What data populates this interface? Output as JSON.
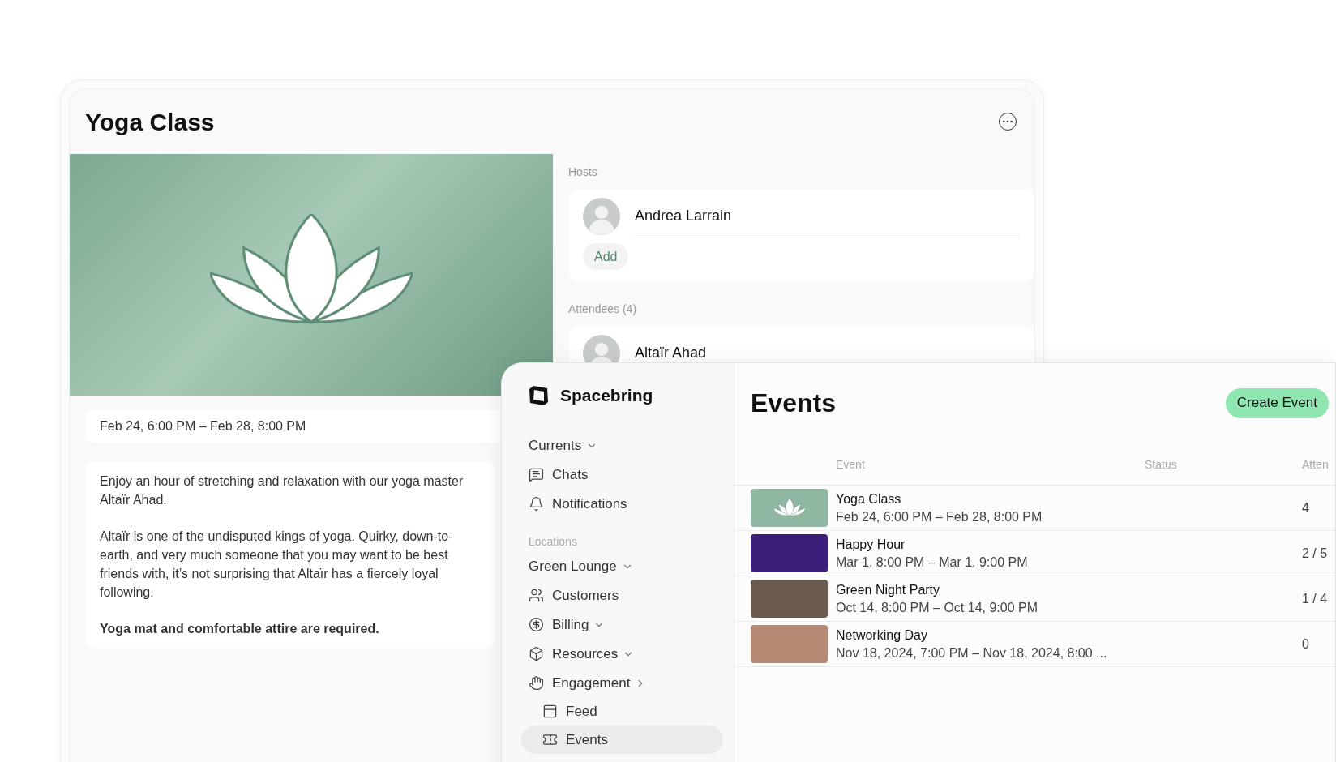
{
  "event_window": {
    "title": "Yoga Class",
    "date": "Feb 24, 6:00 PM – Feb 28, 8:00 PM",
    "description": [
      {
        "text": "Enjoy an hour of stretching and relaxation with our yoga master Altaïr Ahad.",
        "bold": false
      },
      {
        "text": "Altaïr is one of the undisputed kings of yoga. Quirky, down-to-earth, and very much someone that you may want to be best friends with, it’s not surprising that Altaïr has a fiercely loyal following.",
        "bold": false
      },
      {
        "text": "Yoga mat and comfortable attire are required.",
        "bold": true
      }
    ],
    "hosts": {
      "label": "Hosts",
      "people": [
        "Andrea Larrain"
      ],
      "add_button": "Add"
    },
    "attendees": {
      "label": "Attendees (4)",
      "people": [
        "Altaïr Ahad"
      ]
    }
  },
  "app_window": {
    "sidebar": {
      "logo": "Spacebring",
      "items": [
        {
          "kind": "group",
          "label": "Currents",
          "expanded": true
        },
        {
          "kind": "link",
          "label": "Chats",
          "selected": false
        },
        {
          "kind": "link",
          "label": "Notifications",
          "selected": false
        },
        {
          "kind": "caption",
          "label": "Locations"
        },
        {
          "kind": "group",
          "label": "Green Lounge",
          "expanded": true
        },
        {
          "kind": "link",
          "label": "Customers",
          "selected": false
        },
        {
          "kind": "link",
          "label": "Billing",
          "selected": false,
          "expanded": true
        },
        {
          "kind": "link",
          "label": "Resources",
          "selected": false,
          "expanded": true
        },
        {
          "kind": "link",
          "label": "Engagement",
          "selected": false,
          "expanded": false,
          "children": [
            {
              "kind": "link",
              "label": "Feed",
              "selected": false
            },
            {
              "kind": "link",
              "label": "Events",
              "selected": true
            }
          ]
        }
      ]
    },
    "page": {
      "title": "Events",
      "create_button": "Create Event",
      "table": {
        "columns": [
          "Event",
          "Status",
          "Atten"
        ],
        "rows": [
          {
            "name": "Yoga Class",
            "dates": "Feb 24, 6:00 PM – Feb 28, 8:00 PM",
            "attendees": "4"
          },
          {
            "name": "Happy Hour",
            "dates": "Mar 1, 8:00 PM – Mar 1, 9:00 PM",
            "attendees": "2 / 5"
          },
          {
            "name": "Green Night Party",
            "dates": "Oct 14, 8:00 PM – Oct 14, 9:00 PM",
            "attendees": "1 / 4"
          },
          {
            "name": "Networking Day",
            "dates": "Nov 18, 2024, 7:00 PM – Nov 18, 2024, 8:00 ...",
            "attendees": "0"
          }
        ]
      }
    }
  }
}
